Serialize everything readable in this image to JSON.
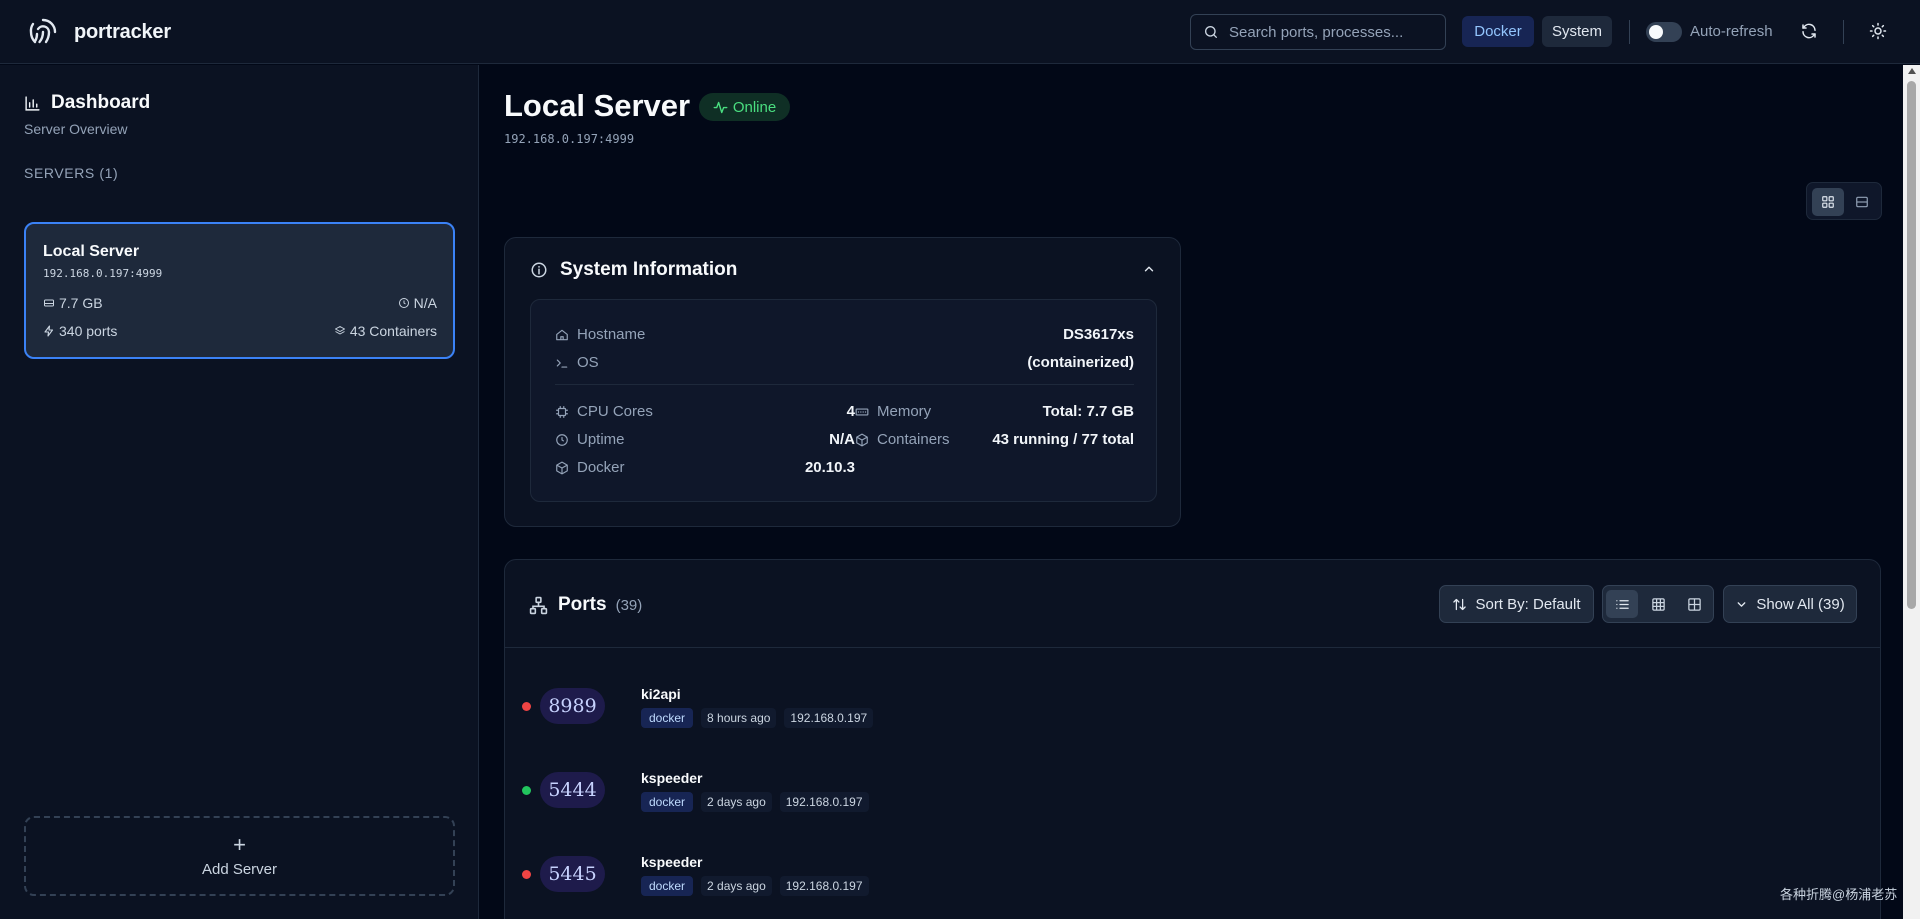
{
  "header": {
    "brand": "portracker",
    "search_placeholder": "Search ports, processes...",
    "filter_docker": "Docker",
    "filter_system": "System",
    "auto_refresh_label": "Auto-refresh"
  },
  "sidebar": {
    "title": "Dashboard",
    "subtitle": "Server Overview",
    "servers_label": "SERVERS (1)",
    "server": {
      "name": "Local Server",
      "ip": "192.168.0.197:4999",
      "memory": "7.7 GB",
      "uptime": "N/A",
      "ports": "340 ports",
      "containers": "43 Containers"
    },
    "add_server_label": "Add Server"
  },
  "main": {
    "title": "Local Server",
    "status": "Online",
    "address": "192.168.0.197:4999",
    "system_info": {
      "title": "System Information",
      "hostname_label": "Hostname",
      "hostname": "DS3617xs",
      "os_label": "OS",
      "os": "(containerized)",
      "cpu_label": "CPU Cores",
      "cpu": "4",
      "uptime_label": "Uptime",
      "uptime": "N/A",
      "docker_label": "Docker",
      "docker": "20.10.3",
      "memory_label": "Memory",
      "memory": "Total: 7.7 GB",
      "containers_label": "Containers",
      "containers": "43 running / 77 total"
    },
    "ports": {
      "title": "Ports",
      "count": "(39)",
      "sort_label": "Sort By: Default",
      "show_all_label": "Show All (39)",
      "items": [
        {
          "port": "8989",
          "name": "ki2api",
          "source": "docker",
          "time": "8 hours ago",
          "host": "192.168.0.197",
          "status_color": "#ef4444"
        },
        {
          "port": "5444",
          "name": "kspeeder",
          "source": "docker",
          "time": "2 days ago",
          "host": "192.168.0.197",
          "status_color": "#22c55e"
        },
        {
          "port": "5445",
          "name": "kspeeder",
          "source": "docker",
          "time": "2 days ago",
          "host": "192.168.0.197",
          "status_color": "#ef4444"
        }
      ]
    }
  },
  "watermark": "各种折腾@杨浦老苏"
}
